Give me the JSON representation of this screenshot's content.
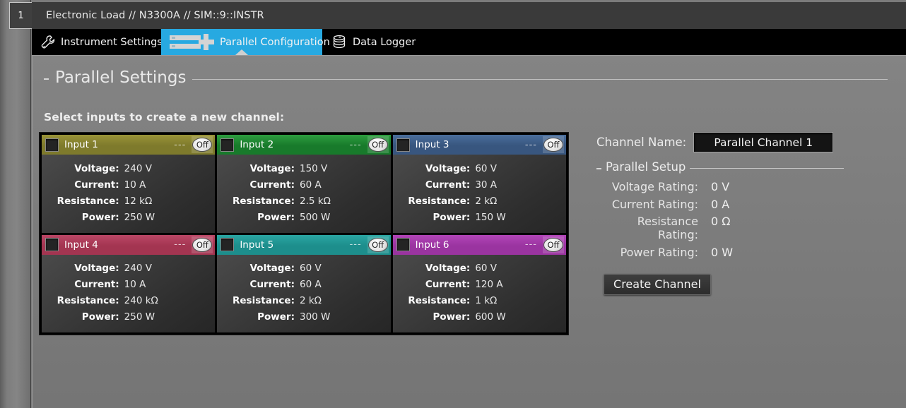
{
  "window": {
    "tab_number": "1",
    "title": "Electronic Load // N3300A // SIM::9::INSTR"
  },
  "tabs": [
    {
      "label": "Instrument Settings",
      "icon": "wrench-icon",
      "active": false
    },
    {
      "label": "Parallel Configuration",
      "icon": "parallel-icon",
      "active": true
    },
    {
      "label": "Data Logger",
      "icon": "database-icon",
      "active": false
    }
  ],
  "section": {
    "title": "Parallel Settings",
    "subtitle": "Select inputs to create a new channel:"
  },
  "labels": {
    "voltage": "Voltage:",
    "current": "Current:",
    "resistance": "Resistance:",
    "power": "Power:",
    "state_dashes": "---",
    "state_badge": "Off"
  },
  "inputs": [
    {
      "name": "Input 1",
      "color": "#7e7a2c",
      "color2": "#9a9438",
      "checked": false,
      "state": "---",
      "badge": "Off",
      "voltage": "240 V",
      "current": "10 A",
      "resistance": "12 kΩ",
      "power": "250 W"
    },
    {
      "name": "Input 2",
      "color": "#187a2b",
      "color2": "#2d9d3f",
      "checked": false,
      "state": "---",
      "badge": "Off",
      "voltage": "150 V",
      "current": "60 A",
      "resistance": "2.5 kΩ",
      "power": "500 W"
    },
    {
      "name": "Input 3",
      "color": "#38567f",
      "color2": "#4a6e9c",
      "checked": false,
      "state": "---",
      "badge": "Off",
      "voltage": "60 V",
      "current": "30 A",
      "resistance": "2 kΩ",
      "power": "150 W"
    },
    {
      "name": "Input 4",
      "color": "#a33551",
      "color2": "#bb4766",
      "checked": false,
      "state": "---",
      "badge": "Off",
      "voltage": "240 V",
      "current": "10 A",
      "resistance": "240 kΩ",
      "power": "250 W"
    },
    {
      "name": "Input 5",
      "color": "#1d8e8c",
      "color2": "#2aa6a3",
      "checked": false,
      "state": "---",
      "badge": "Off",
      "voltage": "60 V",
      "current": "60 A",
      "resistance": "2 kΩ",
      "power": "300 W"
    },
    {
      "name": "Input 6",
      "color": "#9a34a0",
      "color2": "#b245b8",
      "checked": false,
      "state": "---",
      "badge": "Off",
      "voltage": "60 V",
      "current": "120 A",
      "resistance": "1 kΩ",
      "power": "600 W"
    }
  ],
  "right": {
    "channel_name_label": "Channel Name:",
    "channel_name_value": "Parallel Channel 1",
    "setup_title": "Parallel Setup",
    "ratings": [
      {
        "label": "Voltage Rating:",
        "value": "0 V"
      },
      {
        "label": "Current Rating:",
        "value": "0 A"
      },
      {
        "label": "Resistance Rating:",
        "value": "0 Ω"
      },
      {
        "label": "Power Rating:",
        "value": "0 W"
      }
    ],
    "create_button": "Create Channel"
  },
  "colors": {
    "accent": "#27a9e1",
    "panel_bg": "#7c7c7c",
    "tabstrip_bg": "#000000",
    "titlebar_bg": "#3a3a3a"
  }
}
